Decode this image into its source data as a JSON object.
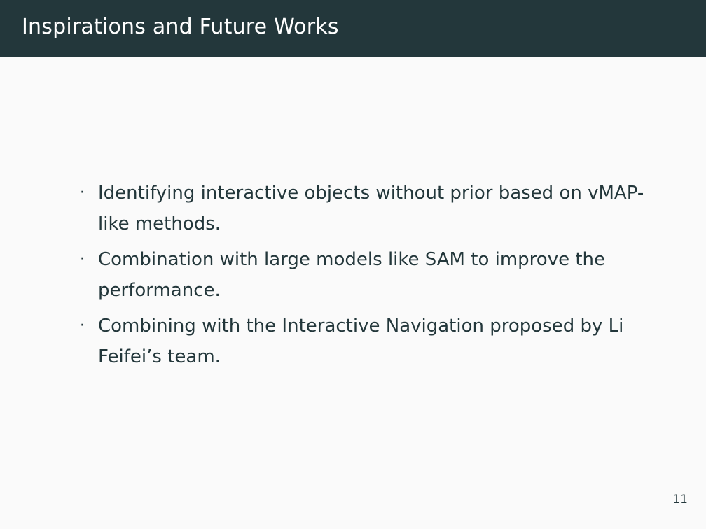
{
  "slide": {
    "title": "Inspirations and Future Works",
    "page_number": "11",
    "bullet_marker": "·",
    "bullets": [
      "Identifying interactive objects without prior based on vMAP-like methods.",
      "Combination with large models like SAM to improve the performance.",
      "Combining with the Interactive Navigation proposed by Li Feifei’s team."
    ]
  },
  "colors": {
    "header_background": "#23373b",
    "header_text": "#ffffff",
    "body_background": "#fafafa",
    "body_text": "#23373b"
  }
}
